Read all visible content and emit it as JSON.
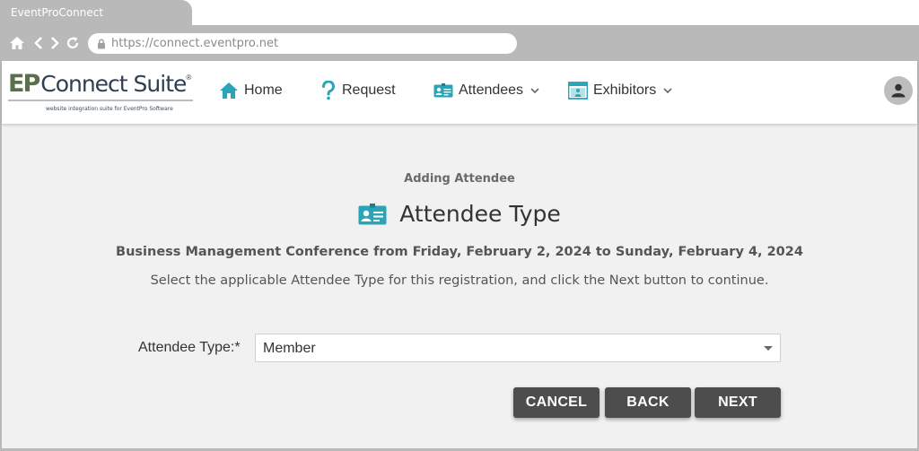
{
  "browser": {
    "tab_title": "EventProConnect",
    "url": "https://connect.eventpro.net"
  },
  "logo": {
    "ep": "EP",
    "suite": "Connect Suite",
    "registered": "®",
    "tagline": "website integration suite for EventPro Software"
  },
  "nav": {
    "home": "Home",
    "request": "Request",
    "attendees": "Attendees",
    "exhibitors": "Exhibitors"
  },
  "page": {
    "subtitle": "Adding Attendee",
    "title": "Attendee Type",
    "event": "Business Management Conference from Friday, February 2, 2024 to Sunday, February 4, 2024",
    "instructions": "Select the applicable Attendee Type for this registration, and click the Next button to continue."
  },
  "form": {
    "attendee_type_label": "Attendee Type:*",
    "attendee_type_value": "Member"
  },
  "buttons": {
    "cancel": "CANCEL",
    "back": "BACK",
    "next": "NEXT"
  },
  "icons": {
    "home": "home-icon",
    "request": "question-icon",
    "attendees": "badge-icon",
    "exhibitors": "booth-icon",
    "account": "user-icon"
  },
  "colors": {
    "accent": "#2aa5b8",
    "button": "#4d4d4d",
    "chrome": "#b9b9b9",
    "content_bg": "#f1f1f1"
  }
}
